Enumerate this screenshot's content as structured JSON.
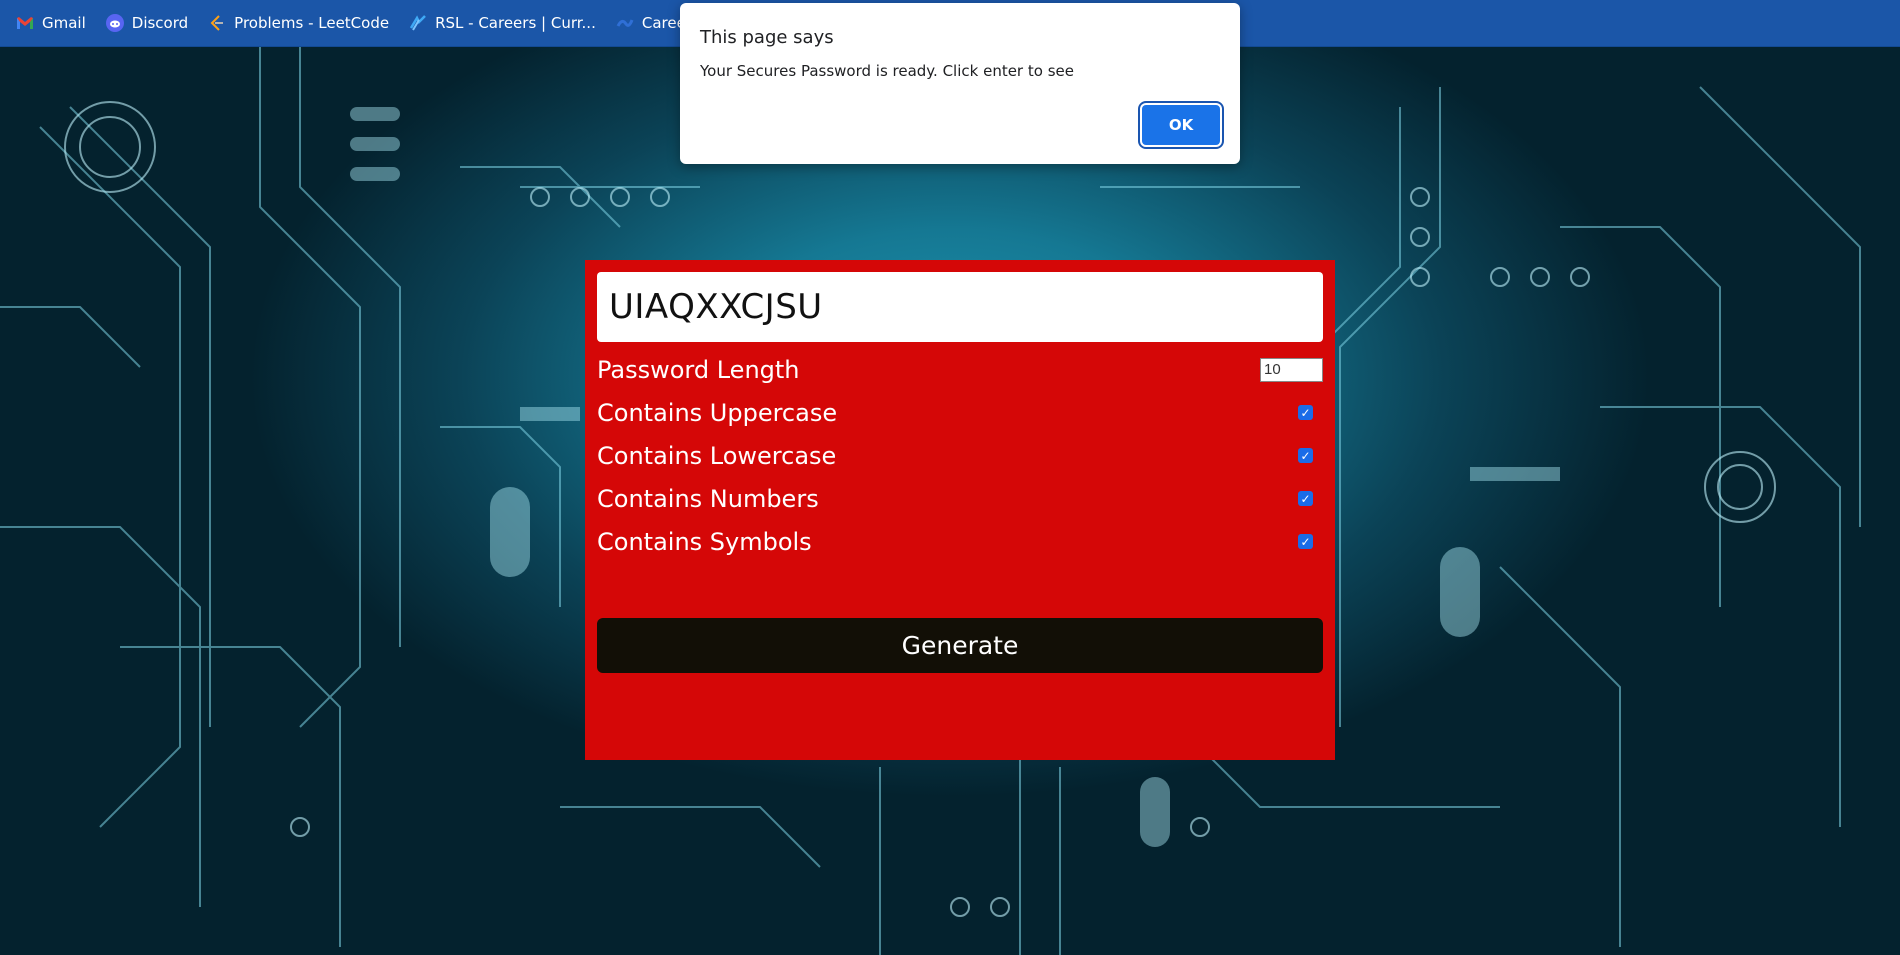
{
  "bookmarks": [
    {
      "label": "Gmail",
      "icon": "gmail-icon"
    },
    {
      "label": "Discord",
      "icon": "discord-icon"
    },
    {
      "label": "Problems - LeetCode",
      "icon": "leetcode-icon"
    },
    {
      "label": "RSL - Careers | Curr...",
      "icon": "rsl-icon"
    },
    {
      "label": "Careers -",
      "icon": "careers-icon"
    }
  ],
  "dialog": {
    "title": "This page says",
    "message": "Your Secures Password is ready. Click enter to see",
    "ok_label": "OK"
  },
  "generator": {
    "password": "UIAQXXCJSU",
    "length_label": "Password Length",
    "length_value": "10",
    "options": [
      {
        "label": "Contains Uppercase",
        "checked": true
      },
      {
        "label": "Contains Lowercase",
        "checked": true
      },
      {
        "label": "Contains Numbers",
        "checked": true
      },
      {
        "label": "Contains Symbols",
        "checked": true
      }
    ],
    "generate_label": "Generate"
  },
  "colors": {
    "card": "#d50707",
    "button": "#120f06",
    "bookmark_bar": "#1b56a8",
    "accent": "#1a73e8"
  }
}
